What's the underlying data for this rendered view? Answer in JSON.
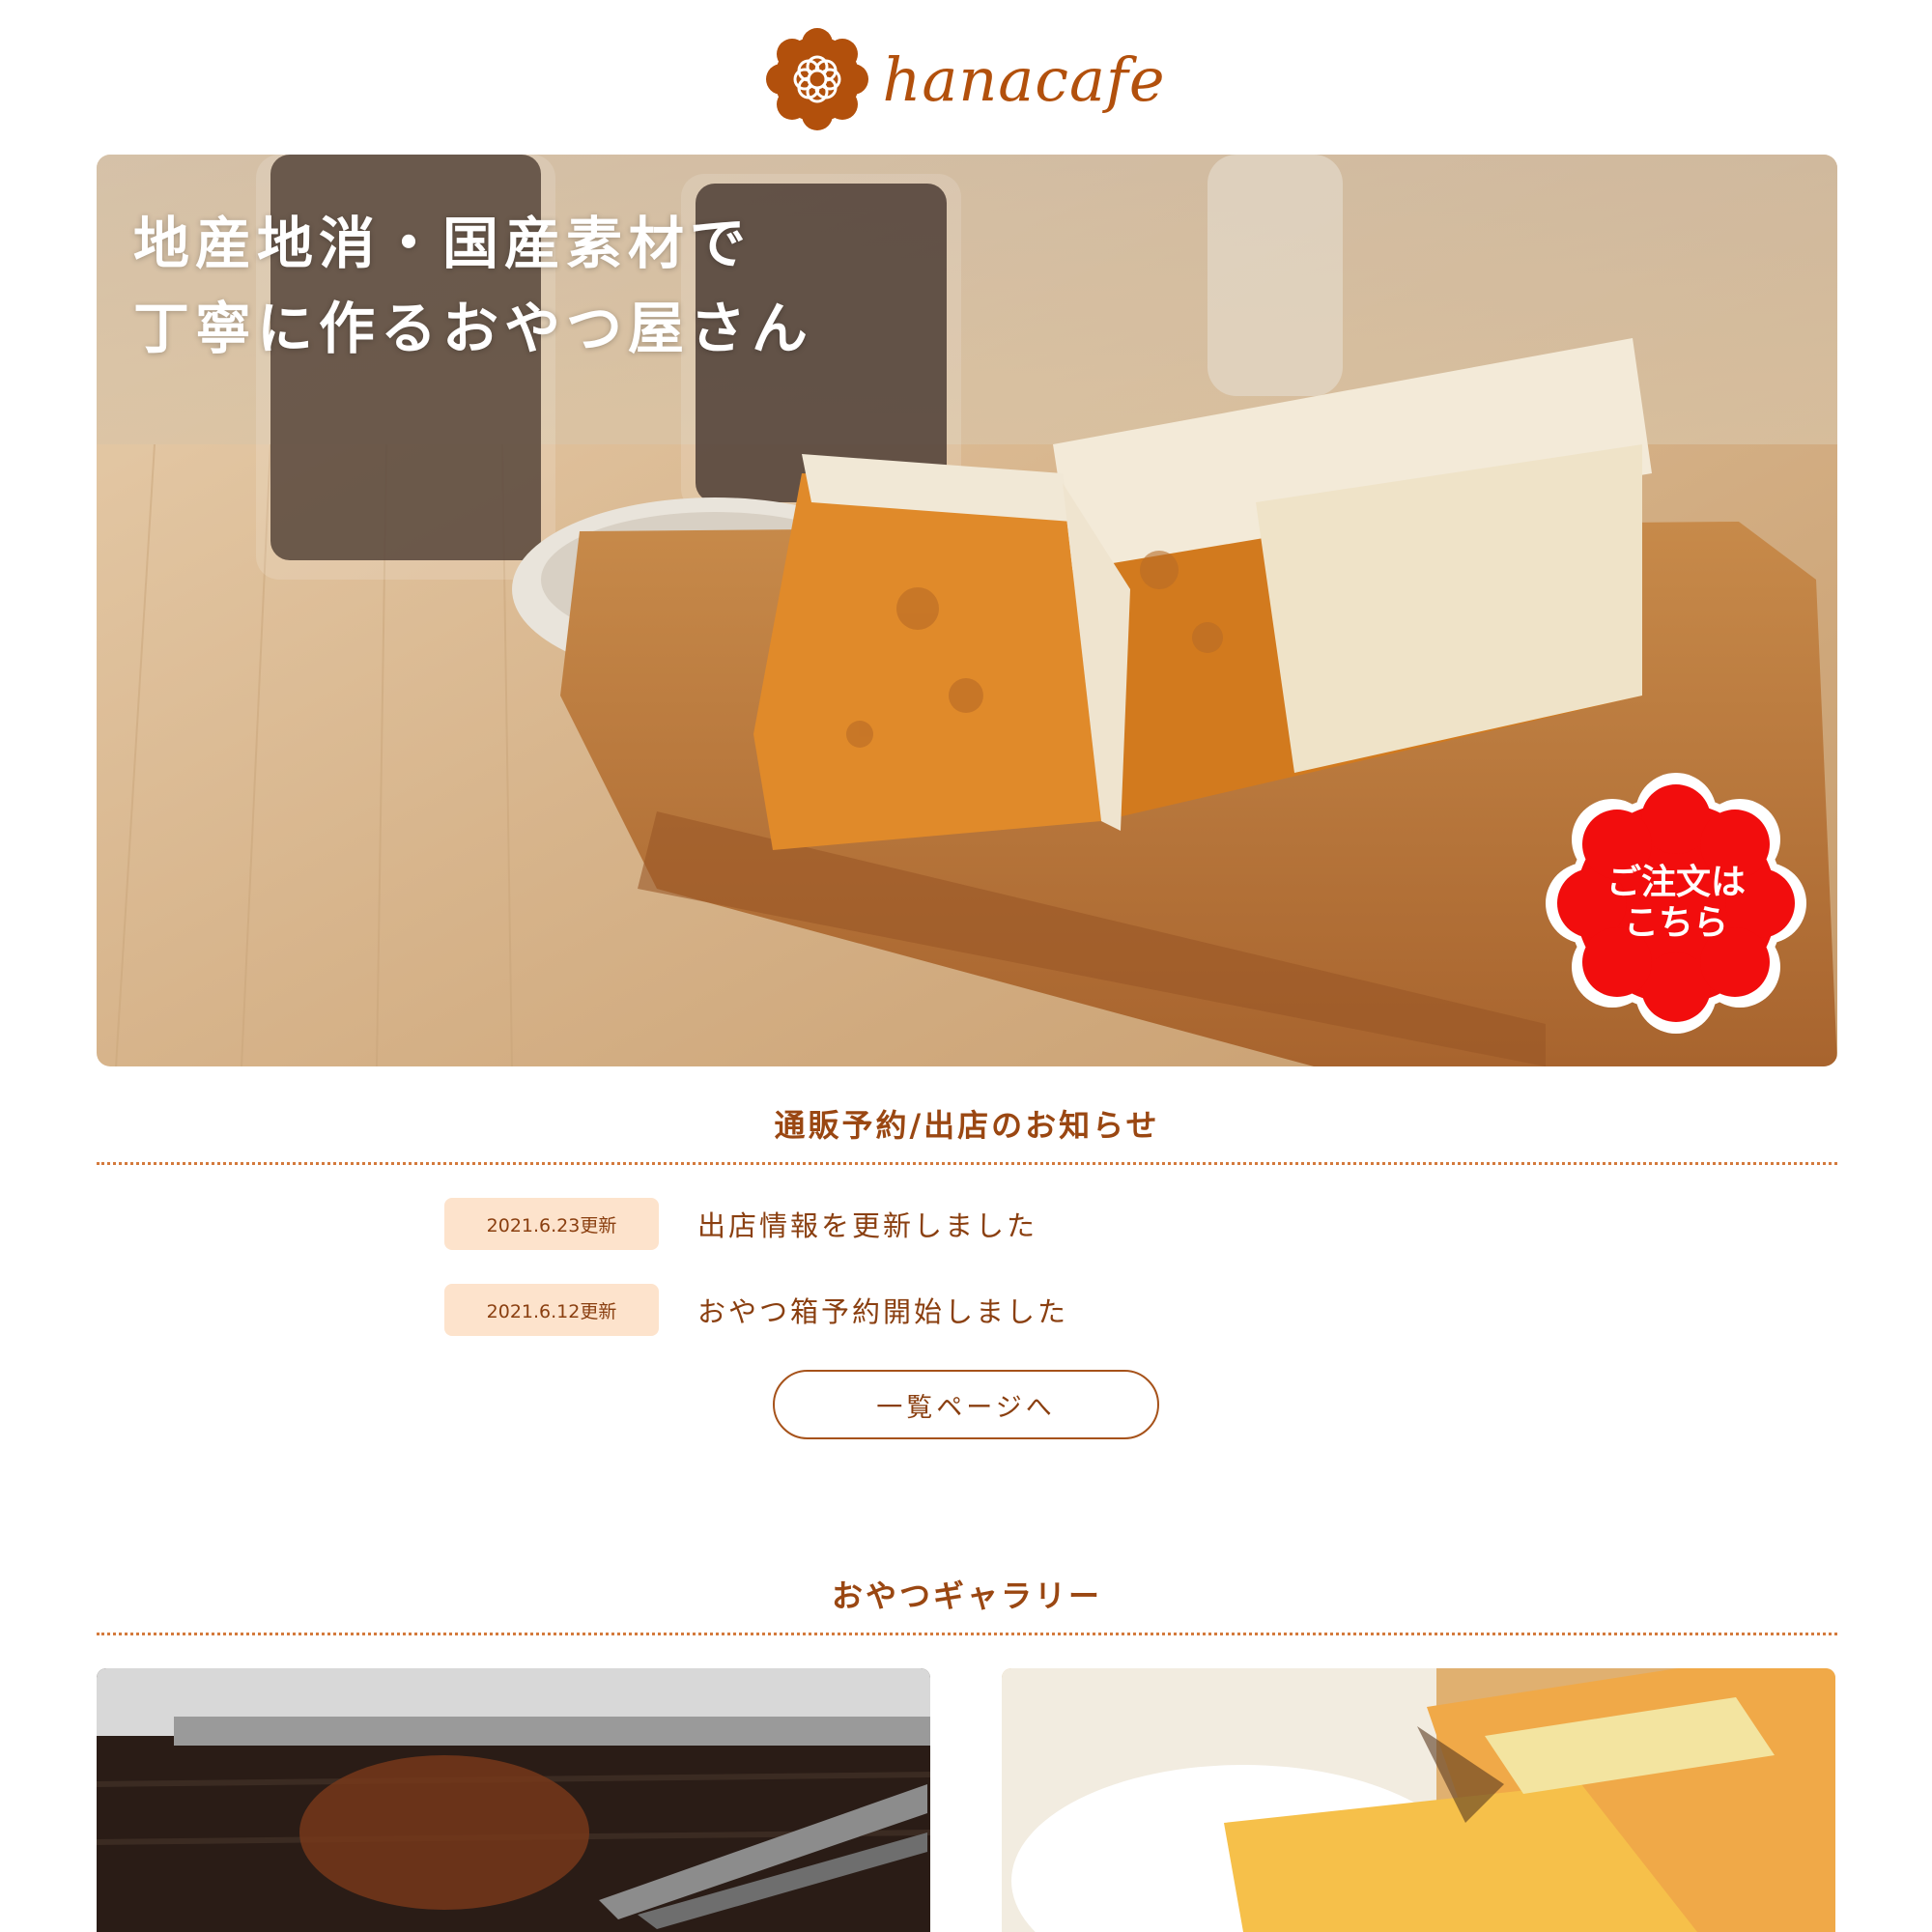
{
  "header": {
    "logo_text": "hanacafe",
    "logo_icon": "flower-icon"
  },
  "hero": {
    "title_line1": "地産地消・国産素材で",
    "title_line2": "丁寧に作るおやつ屋さん",
    "order_badge_line1": "ご注文は",
    "order_badge_line2": "こちら"
  },
  "news": {
    "title": "通販予約/出店のお知らせ",
    "items": [
      {
        "date": "2021.6.23更新",
        "text": "出店情報を更新しました"
      },
      {
        "date": "2021.6.12更新",
        "text": "おやつ箱予約開始しました"
      }
    ],
    "list_button_label": "一覧ページへ"
  },
  "gallery": {
    "title": "おやつギャラリー"
  },
  "colors": {
    "brand": "#b2500c",
    "text": "#8a3f10",
    "badge": "#f20d0d",
    "date_bg": "#fde3cc"
  }
}
